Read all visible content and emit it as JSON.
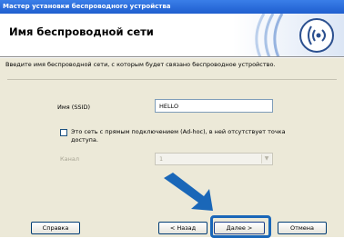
{
  "window": {
    "title": "Мастер установки беспроводного устройства"
  },
  "header": {
    "title": "Имя беспроводной сети",
    "logo_icon": "wireless-signal-icon"
  },
  "main": {
    "description": "Введите имя беспроводной сети, с которым будет связано беспроводное устройство.",
    "ssid": {
      "label": "Имя (SSID)",
      "value": "HELLO"
    },
    "adhoc": {
      "label": "Это сеть с прямым подключением (Ad-hoc), в ней отсутствует точка доступа.",
      "checked": false
    },
    "channel": {
      "label": "Канал",
      "value": "1",
      "enabled": false
    }
  },
  "buttons": {
    "help": "Справка",
    "back": "< Назад",
    "next": "Далее >",
    "cancel": "Отмена"
  },
  "colors": {
    "titlebar": "#2a6fdb",
    "panel": "#ece9d8",
    "accent": "#1a67b8"
  }
}
